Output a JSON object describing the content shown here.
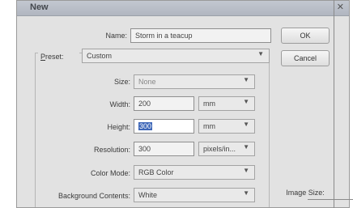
{
  "window": {
    "title": "New"
  },
  "form": {
    "name_label": "Name:",
    "name_value": "Storm in a teacup",
    "preset_label": "Preset:",
    "preset_value": "Custom",
    "size_label": "Size:",
    "size_value": "None",
    "width_label": "Width:",
    "width_value": "200",
    "width_unit": "mm",
    "height_label": "Height:",
    "height_value": "300",
    "height_unit": "mm",
    "resolution_label": "Resolution:",
    "resolution_value": "300",
    "resolution_unit": "pixels/in...",
    "color_mode_label": "Color Mode:",
    "color_mode_value": "RGB Color",
    "background_label": "Background Contents:",
    "background_value": "White"
  },
  "buttons": {
    "ok": "OK",
    "cancel": "Cancel"
  },
  "info": {
    "image_size_label": "Image Size:"
  },
  "icons": {
    "close": "close-icon",
    "dropdown": "chevron-down-icon"
  }
}
